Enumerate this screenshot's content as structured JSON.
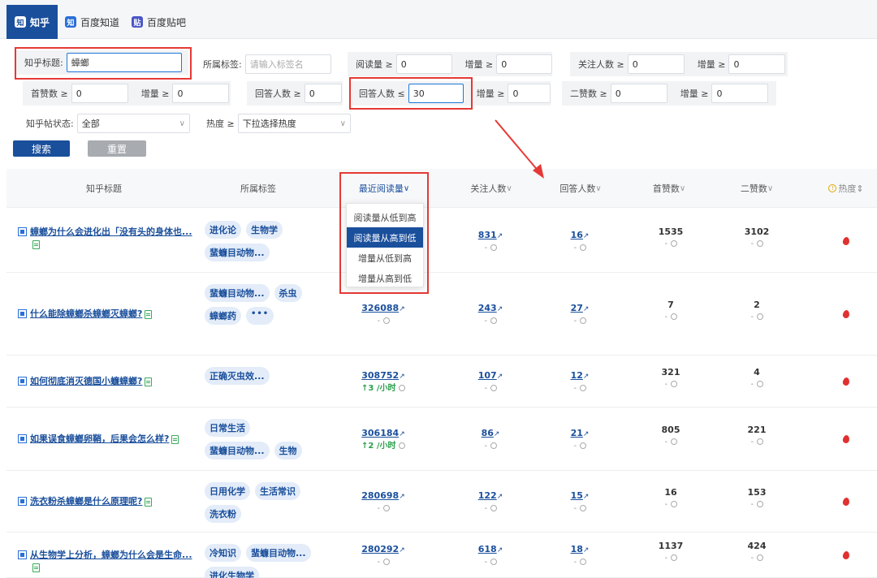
{
  "tabs": [
    {
      "label": "知乎",
      "icon": "知",
      "active": true
    },
    {
      "label": "百度知道",
      "icon": "知",
      "active": false
    },
    {
      "label": "百度贴吧",
      "icon": "贴",
      "active": false
    }
  ],
  "filters": {
    "title_label": "知乎标题:",
    "title_value": "蟑螂",
    "tag_label": "所属标签:",
    "tag_placeholder": "请输入标签名",
    "read_label": "阅读量 ≥",
    "read_value": "0",
    "inc_label": "增量 ≥",
    "inc1_value": "0",
    "follow_label": "关注人数 ≥",
    "follow_value": "0",
    "inc2_value": "0",
    "firstlike_label": "首赞数 ≥",
    "firstlike_value": "0",
    "inc3_value": "0",
    "answer_label": "回答人数 ≥",
    "answer_value": "0",
    "answer_max_label": "回答人数 ≤",
    "answer_max_value": "30",
    "inc4_value": "0",
    "secondlike_label": "二赞数 ≥",
    "secondlike_value": "0",
    "inc5_value": "0",
    "status_label": "知乎帖状态:",
    "status_value": "全部",
    "heat_label": "热度 ≥",
    "heat_value": "下拉选择热度",
    "search_btn": "搜索",
    "reset_btn": "重置"
  },
  "table": {
    "headers": {
      "title": "知乎标题",
      "tags": "所属标签",
      "reads": "最近阅读量",
      "follows": "关注人数",
      "answers": "回答人数",
      "first_likes": "首赞数",
      "second_likes": "二赞数",
      "heat": "热度"
    },
    "header_chevron": "∨",
    "heat_sort": "⇕",
    "rows": [
      {
        "title_line1": "蟑螂为什么会进化出「没有头的身体也...",
        "tags": [
          "进化论",
          "生物学",
          "蜚蠊目动物..."
        ],
        "reads": "",
        "reads_sub": "",
        "follows": "831",
        "follows_sub": "-",
        "answers": "16",
        "answers_sub": "-",
        "first": "1535",
        "first_sub": "-",
        "second": "3102",
        "second_sub": "-"
      },
      {
        "title_line1": "什么能除蟑螂杀蟑螂灭蟑螂?",
        "tags": [
          "蜚蠊目动物...",
          "杀虫",
          "蟑螂药",
          "•••"
        ],
        "reads": "326088",
        "reads_sub": "-",
        "follows": "243",
        "follows_sub": "-",
        "answers": "27",
        "answers_sub": "-",
        "first": "7",
        "first_sub": "-",
        "second": "2",
        "second_sub": "-"
      },
      {
        "title_line1": "如何彻底消灭德国小蠊蟑螂?",
        "tags": [
          "正确灭虫效..."
        ],
        "reads": "308752",
        "reads_sub": "↑3 /小时",
        "follows": "107",
        "follows_sub": "-",
        "answers": "12",
        "answers_sub": "-",
        "first": "321",
        "first_sub": "-",
        "second": "4",
        "second_sub": "-"
      },
      {
        "title_line1": "如果误食蟑螂卵鞘，后果会怎么样?",
        "tags": [
          "日常生活",
          "蜚蠊目动物...",
          "生物"
        ],
        "reads": "306184",
        "reads_sub": "↑2 /小时",
        "follows": "86",
        "follows_sub": "-",
        "answers": "21",
        "answers_sub": "-",
        "first": "805",
        "first_sub": "-",
        "second": "221",
        "second_sub": "-"
      },
      {
        "title_line1": "洗衣粉杀蟑螂是什么原理呢?",
        "tags": [
          "日用化学",
          "生活常识",
          "洗衣粉"
        ],
        "reads": "280698",
        "reads_sub": "-",
        "follows": "122",
        "follows_sub": "-",
        "answers": "15",
        "answers_sub": "-",
        "first": "16",
        "first_sub": "-",
        "second": "153",
        "second_sub": "-"
      },
      {
        "title_line1": "从生物学上分析，蟑螂为什么会是生命...",
        "tags": [
          "冷知识",
          "蜚蠊目动物...",
          "进化生物学"
        ],
        "reads": "280292",
        "reads_sub": "-",
        "follows": "618",
        "follows_sub": "-",
        "answers": "18",
        "answers_sub": "-",
        "first": "1137",
        "first_sub": "-",
        "second": "424",
        "second_sub": "-"
      }
    ]
  },
  "dropdown": {
    "items": [
      "阅读量从低到高",
      "阅读量从高到低",
      "增量从低到高",
      "增量从高到低"
    ],
    "active_index": 1
  },
  "colors": {
    "accent": "#1a4f9c",
    "highlight": "#e53935",
    "up": "#2b9f4d",
    "flame": "#e03030"
  }
}
